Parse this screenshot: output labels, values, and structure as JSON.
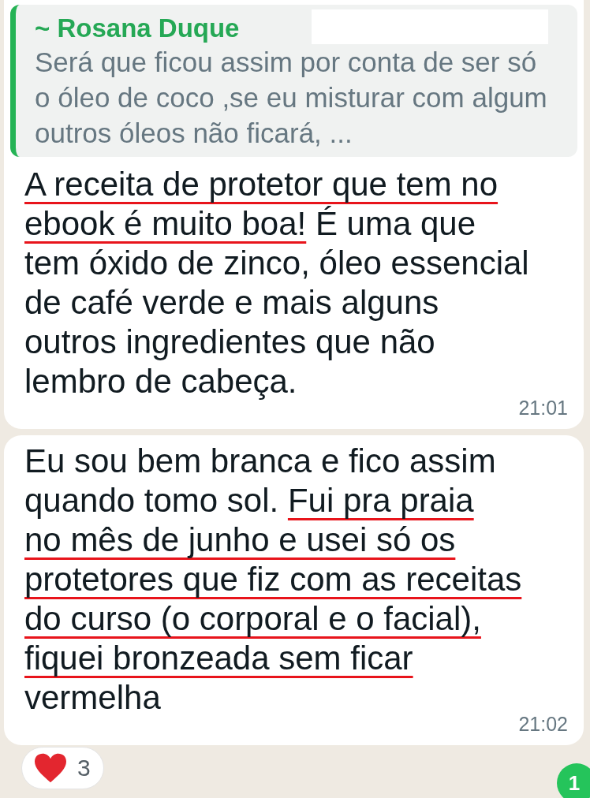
{
  "messages": [
    {
      "quote": {
        "author": "~ Rosana Duque",
        "redacted": true,
        "text": "Será que ficou assim por conta de ser só o óleo de coco ,se eu misturar com algum outros óleos não ficará, ..."
      },
      "lines": [
        [
          {
            "text": "A receita de protetor que tem no",
            "underlined": true
          }
        ],
        [
          {
            "text": "ebook é muito boa!",
            "underlined": true
          },
          {
            "text": " É uma que",
            "underlined": false
          }
        ],
        [
          {
            "text": "tem óxido de zinco, óleo essencial",
            "underlined": false
          }
        ],
        [
          {
            "text": "de café verde e mais alguns",
            "underlined": false
          }
        ],
        [
          {
            "text": "outros ingredientes que não",
            "underlined": false
          }
        ],
        [
          {
            "text": "lembro de cabeça.",
            "underlined": false
          }
        ]
      ],
      "time": "21:01"
    },
    {
      "lines": [
        [
          {
            "text": "Eu sou bem branca e fico assim",
            "underlined": false
          }
        ],
        [
          {
            "text": "quando tomo sol. ",
            "underlined": false
          },
          {
            "text": "Fui pra praia",
            "underlined": true
          }
        ],
        [
          {
            "text": "no mês de junho e usei só os",
            "underlined": true
          }
        ],
        [
          {
            "text": "protetores que fiz com as receitas",
            "underlined": true
          }
        ],
        [
          {
            "text": "do curso (o corporal e o facial),",
            "underlined": true
          }
        ],
        [
          {
            "text": "fiquei bronzeada sem ficar",
            "underlined": true
          }
        ],
        [
          {
            "text": "vermelha",
            "underlined": false
          }
        ]
      ],
      "time": "21:02",
      "reaction": {
        "count": "3"
      }
    }
  ],
  "unread_badge": "1"
}
